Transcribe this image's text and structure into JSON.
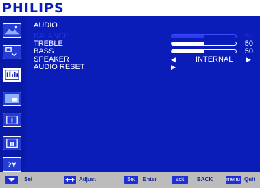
{
  "brand": "PHILIPS",
  "section_title": "AUDIO",
  "menu": {
    "balance": {
      "label": "BALANCE",
      "value": "50",
      "level": 0.5
    },
    "treble": {
      "label": "TREBLE",
      "value": "50",
      "level": 0.5
    },
    "bass": {
      "label": "BASS",
      "value": "50",
      "level": 0.5
    },
    "speaker": {
      "label": "SPEAKER",
      "value": "INTERNAL",
      "left_arrow": "◀",
      "right_arrow": "▶"
    },
    "audio_reset": {
      "label": "AUDIO RESET",
      "arrow": "▶"
    }
  },
  "footer": {
    "sel_label": "Sel",
    "adjust_label": "Adjust",
    "set_key": "Set",
    "enter_label": "Enter",
    "exit_key": "exit",
    "back_label": "BACK",
    "menu_key": "menu",
    "quit_label": "Quit"
  },
  "colors": {
    "background": "#0b1db8",
    "highlight": "#2030f0",
    "footer": "#bcbcbc"
  },
  "icons": {
    "sidebar": [
      "picture-icon",
      "screen-icon",
      "audio-icon",
      "pip-icon",
      "configuration1-icon",
      "configuration2-icon",
      "advanced-option-icon"
    ]
  }
}
